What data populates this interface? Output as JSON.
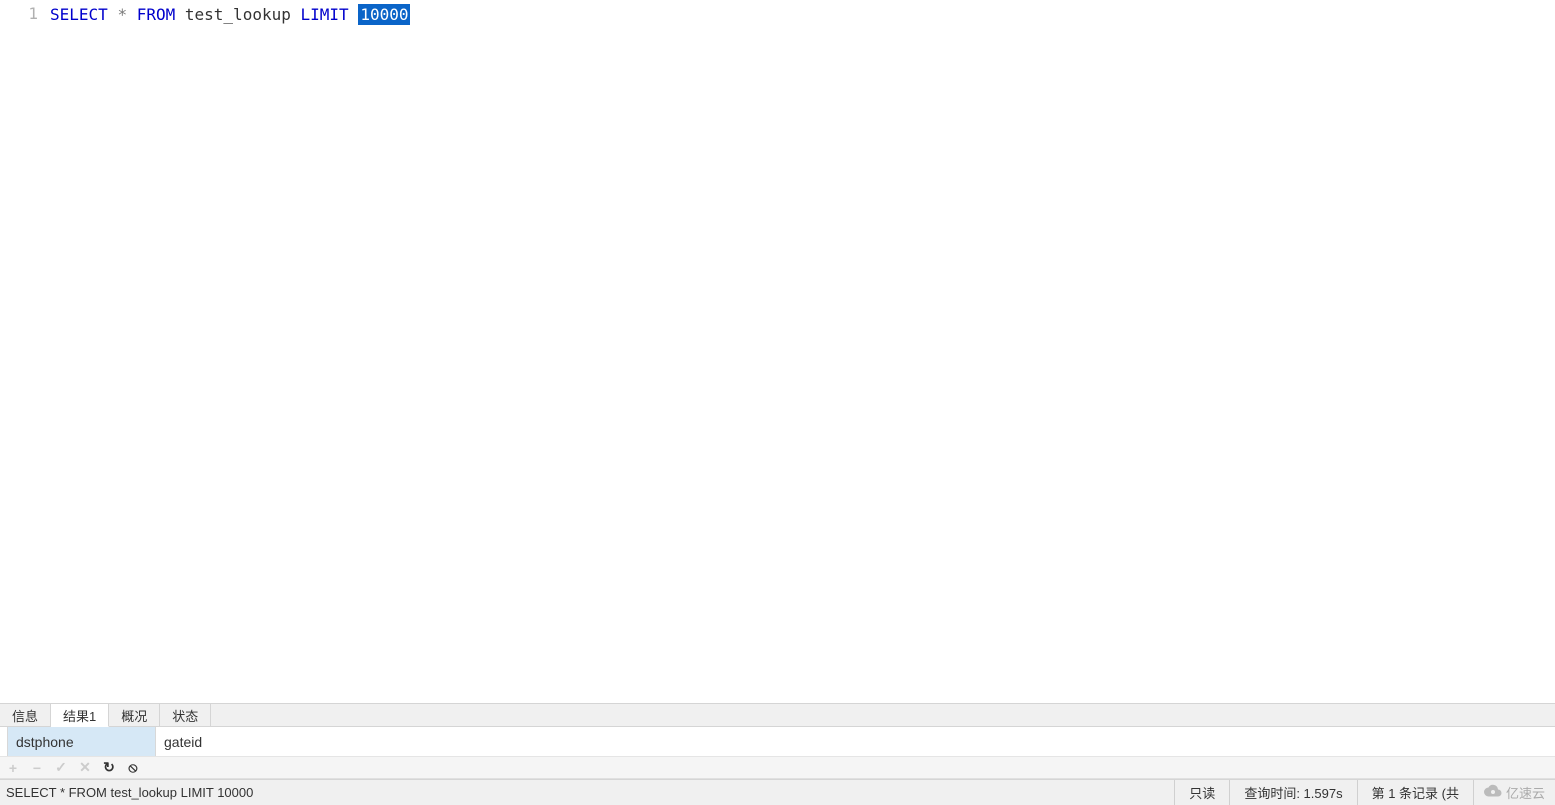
{
  "editor": {
    "line_number": "1",
    "tokens": {
      "select": "SELECT",
      "star": "*",
      "from": "FROM",
      "table": "test_lookup",
      "limit": "LIMIT",
      "number": "10000"
    }
  },
  "tabs": [
    {
      "label": "信息",
      "active": false
    },
    {
      "label": "结果1",
      "active": true
    },
    {
      "label": "概况",
      "active": false
    },
    {
      "label": "状态",
      "active": false
    }
  ],
  "result_columns": [
    {
      "name": "dstphone",
      "selected": true
    },
    {
      "name": "gateid",
      "selected": false
    }
  ],
  "toolbar_icons": {
    "add": "+",
    "remove": "−",
    "check": "✓",
    "cancel": "✕",
    "refresh": "↻",
    "stop": "⦸"
  },
  "status": {
    "query_text": "SELECT * FROM test_lookup LIMIT 10000",
    "readonly": "只读",
    "query_time": "查询时间: 1.597s",
    "record_info": "第 1 条记录 (共",
    "watermark": "亿速云"
  }
}
